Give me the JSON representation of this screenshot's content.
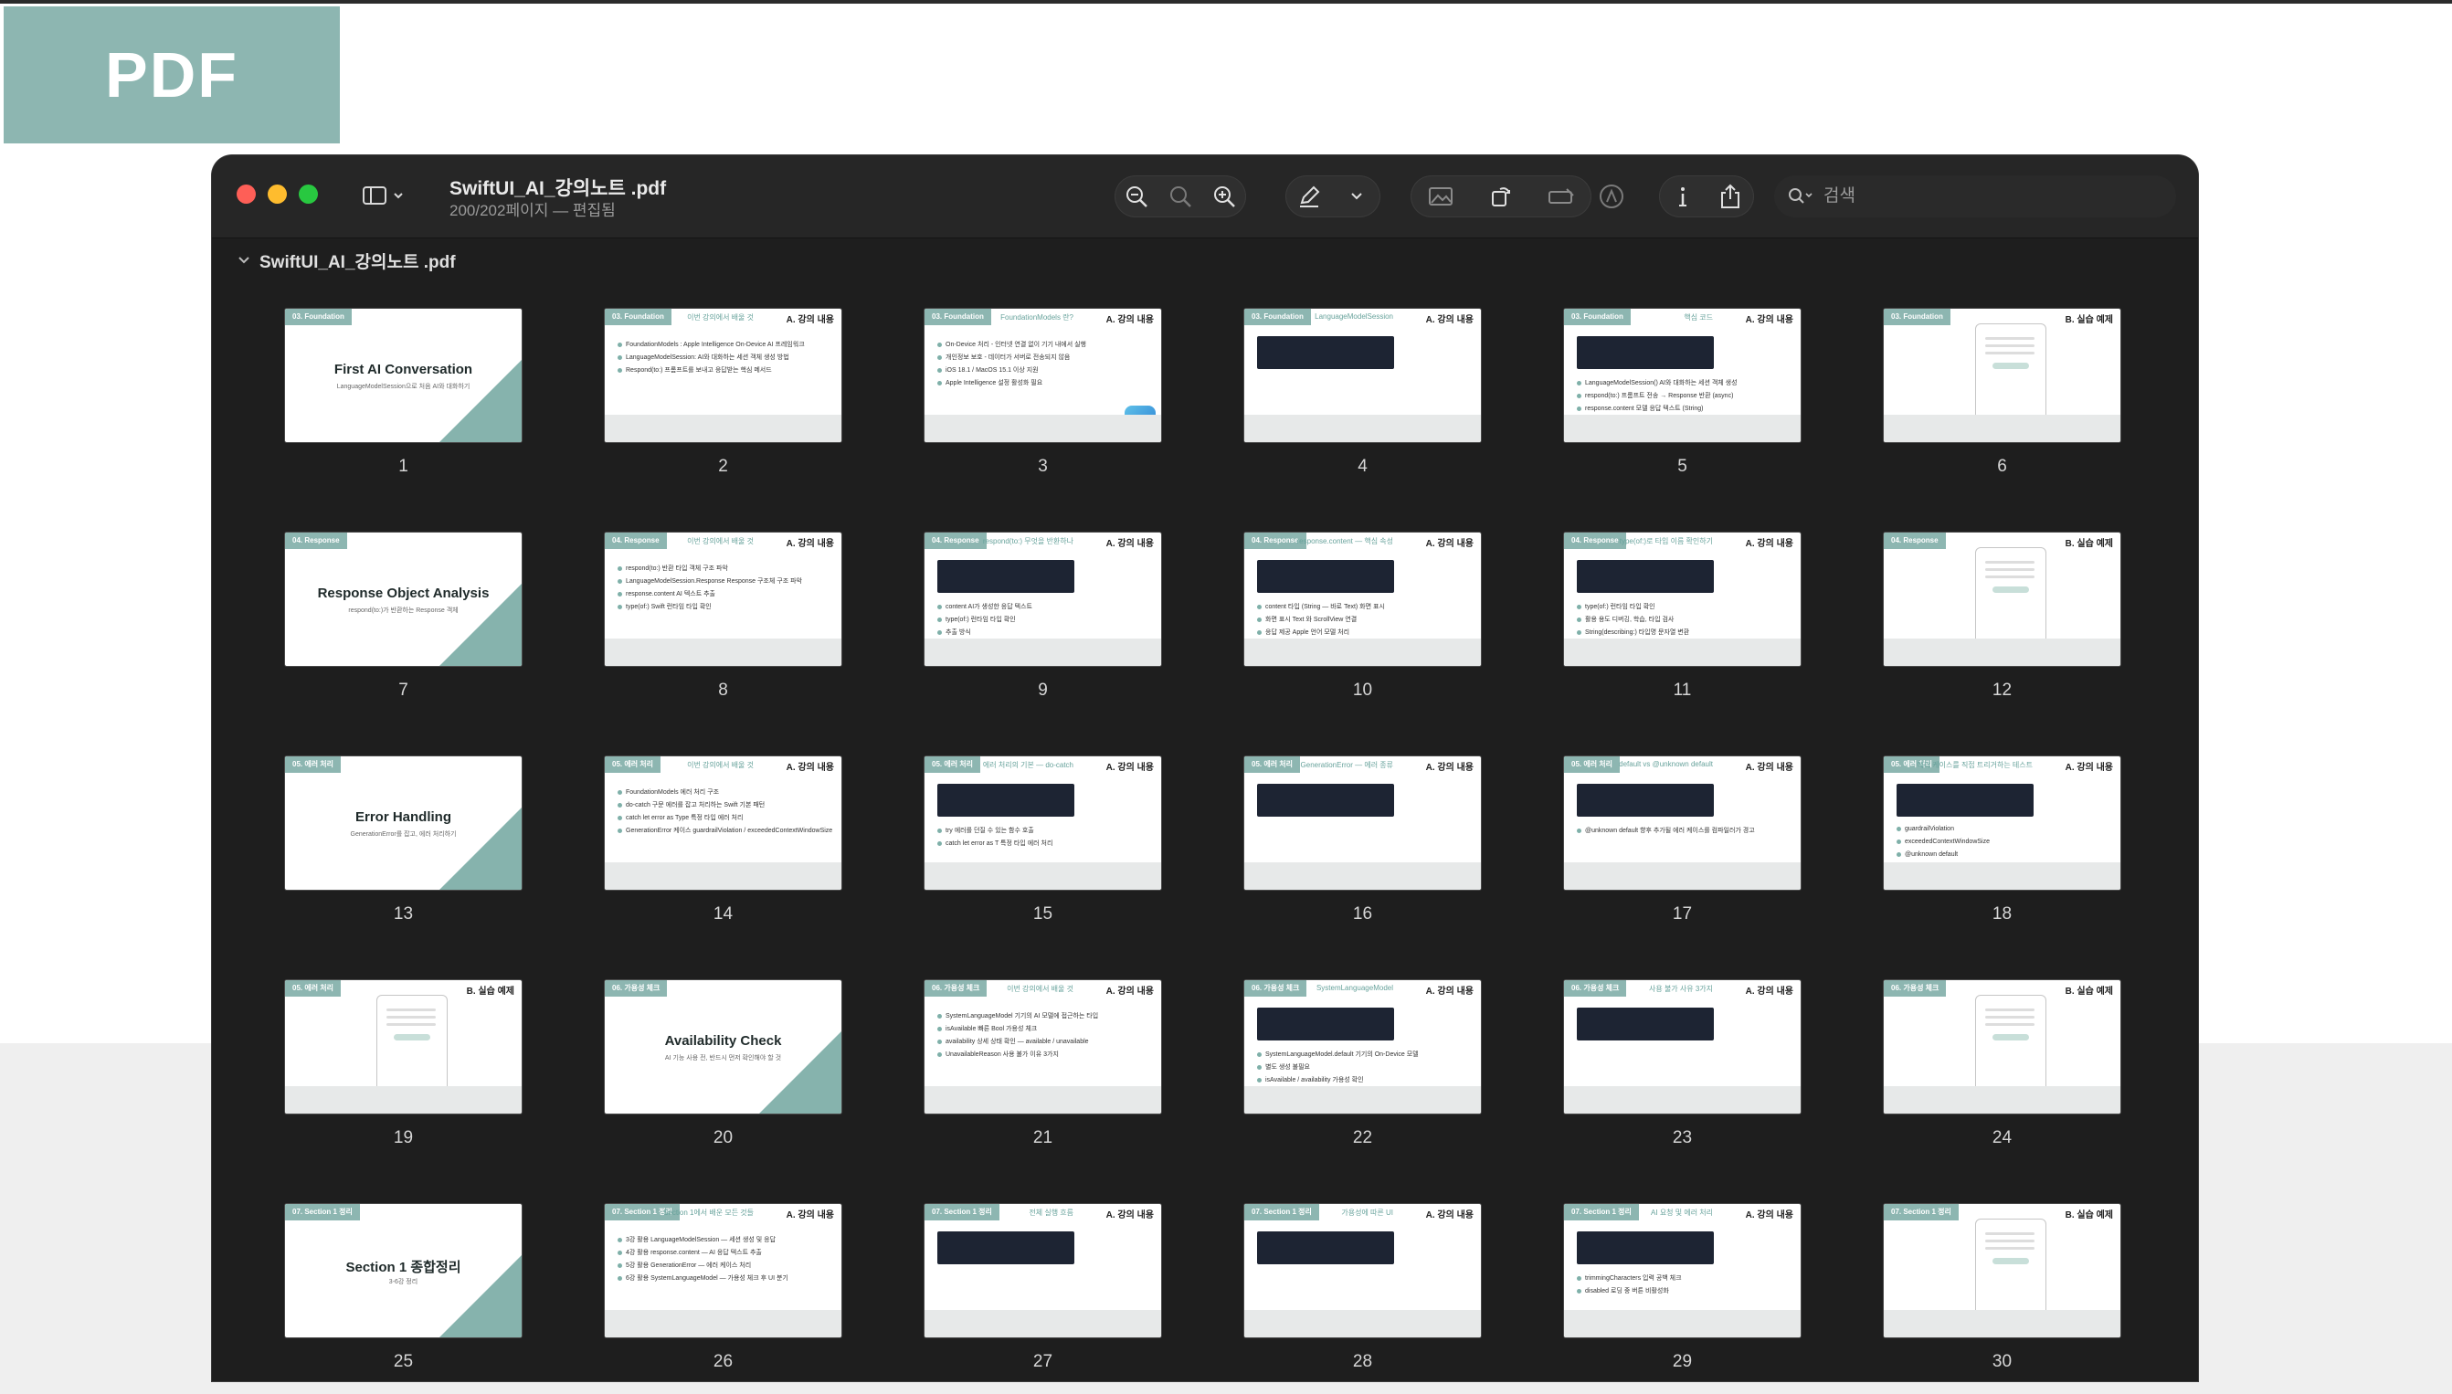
{
  "badge": {
    "label": "PDF"
  },
  "window": {
    "title": "SwiftUI_AI_강의노트 .pdf",
    "subtitle": "200/202페이지 — 편집됨",
    "search_placeholder": "검색",
    "doc_header": "SwiftUI_AI_강의노트 .pdf"
  },
  "colors": {
    "accent": "#8db6b1",
    "window_bg": "#1e1e1e",
    "close": "#fe5f57",
    "minimize": "#febc2e",
    "zoom": "#28c840"
  },
  "toolbar_icons": [
    "sidebar-icon",
    "zoom-out-icon",
    "actual-size-icon",
    "zoom-in-icon",
    "markup-pen-icon",
    "chevron-down-icon",
    "image-edit-icon",
    "rotate-icon",
    "form-icon",
    "annotate-icon",
    "info-icon",
    "share-icon",
    "search-icon"
  ],
  "pages": [
    {
      "num": "1",
      "tag": "03. Foundation",
      "kind": "title",
      "main": "First AI Conversation",
      "sub": "LanguageModelSession으로 처음 AI와 대화하기"
    },
    {
      "num": "2",
      "tag": "03. Foundation",
      "kind": "content",
      "htitle": "이번 강의에서 배울 것",
      "badge": "A. 강의 내용",
      "bullets": [
        "FoundationModels : Apple Intelligence On-Device AI 프레임워크",
        "LanguageModelSession: AI와 대화하는 세션 객체 생성 방법",
        "Respond(to:) 프롬프트를 보내고 응답받는 핵심 메서드"
      ]
    },
    {
      "num": "3",
      "tag": "03. Foundation",
      "kind": "content",
      "htitle": "FoundationModels 란?",
      "badge": "A. 강의 내용",
      "bullets": [
        "On-Device 처리 - 인터넷 연결 없이 기기 내에서 실행",
        "개인정보 보호 - 데이터가 서버로 전송되지 않음",
        "iOS 18.1 / MacOS 15.1 이상 지원",
        "Apple Intelligence 설정 활성화 필요"
      ],
      "icon": true
    },
    {
      "num": "4",
      "tag": "03. Foundation",
      "kind": "content",
      "htitle": "LanguageModelSession",
      "badge": "A. 강의 내용",
      "bullets": [],
      "code": true
    },
    {
      "num": "5",
      "tag": "03. Foundation",
      "kind": "content",
      "htitle": "핵심 코드",
      "badge": "A. 강의 내용",
      "bullets": [
        "LanguageModelSession() AI와 대화하는 세션 객체 생성",
        "respond(to:) 프롬프트 전송 → Response 반환 (async)",
        "response.content 모델 응답 텍스트 (String)"
      ],
      "code": true
    },
    {
      "num": "6",
      "tag": "03. Foundation",
      "kind": "phone",
      "badge": "B. 실습 예제"
    },
    {
      "num": "7",
      "tag": "04. Response",
      "kind": "title",
      "main": "Response Object Analysis",
      "sub": "respond(to:)가 반환하는 Response 객체"
    },
    {
      "num": "8",
      "tag": "04. Response",
      "kind": "content",
      "htitle": "이번 강의에서 배울 것",
      "badge": "A. 강의 내용",
      "bullets": [
        "respond(to:) 반환 타입 객체 구조 파악",
        "LanguageModelSession.Response Response 구조체 구조 파악",
        "response.content AI 텍스트 추출",
        "type(of:) Swift 런타임 타입 확인"
      ]
    },
    {
      "num": "9",
      "tag": "04. Response",
      "kind": "content",
      "htitle": "respond(to:) 무엇을 반환하나",
      "badge": "A. 강의 내용",
      "bullets": [
        "content AI가 생성한 응답 텍스트",
        "type(of:) 런타임 타입 확인",
        "추출 방식"
      ],
      "code": true
    },
    {
      "num": "10",
      "tag": "04. Response",
      "kind": "content",
      "htitle": "response.content — 핵심 속성",
      "badge": "A. 강의 내용",
      "bullets": [
        "content 타입 (String — 바로 Text) 화면 표시",
        "화면 표시 Text 와 ScrollView 연결",
        "응답 제공 Apple 언어 모델 처리"
      ],
      "code": true
    },
    {
      "num": "11",
      "tag": "04. Response",
      "kind": "content",
      "htitle": "type(of:)로 타입 이름 확인하기",
      "badge": "A. 강의 내용",
      "bullets": [
        "type(of:) 런타임 타입 확인",
        "활용 용도 디버깅, 학습, 타입 검사",
        "String(describing:) 타입명 문자열 변환"
      ],
      "code": true
    },
    {
      "num": "12",
      "tag": "04. Response",
      "kind": "phone",
      "badge": "B. 실습 예제"
    },
    {
      "num": "13",
      "tag": "05. 에러 처리",
      "kind": "title",
      "main": "Error Handling",
      "sub": "GenerationError를 잡고, 에러 처리하기"
    },
    {
      "num": "14",
      "tag": "05. 에러 처리",
      "kind": "content",
      "htitle": "이번 강의에서 배울 것",
      "badge": "A. 강의 내용",
      "bullets": [
        "FoundationModels 에러 처리 구조",
        "do-catch 구문 에러를 잡고 처리하는 Swift 기본 패턴",
        "catch let error as Type 특정 타입 에러 처리",
        "GenerationError 케이스 guardrailViolation / exceededContextWindowSize"
      ]
    },
    {
      "num": "15",
      "tag": "05. 에러 처리",
      "kind": "content",
      "htitle": "에러 처리의 기본 — do-catch",
      "badge": "A. 강의 내용",
      "bullets": [
        "try 에러를 던질 수 있는 함수 호출",
        "catch let error as T 특정 타입 에러 처리"
      ],
      "code": true
    },
    {
      "num": "16",
      "tag": "05. 에러 처리",
      "kind": "content",
      "htitle": "GenerationError — 에러 종류",
      "badge": "A. 강의 내용",
      "bullets": [],
      "code": true
    },
    {
      "num": "17",
      "tag": "05. 에러 처리",
      "kind": "content",
      "htitle": "default vs @unknown default",
      "badge": "A. 강의 내용",
      "bullets": [
        "@unknown default 향후 추가될 에러 케이스를 컴파일러가 경고"
      ],
      "code": true
    },
    {
      "num": "18",
      "tag": "05. 에러 처리",
      "kind": "content",
      "htitle": "에러 케이스를 직접 트리거하는 테스트",
      "badge": "A. 강의 내용",
      "bullets": [
        "guardrailViolation",
        "exceededContextWindowSize",
        "@unknown default"
      ],
      "code": true
    },
    {
      "num": "19",
      "tag": "05. 에러 처리",
      "kind": "phone",
      "badge": "B. 실습 예제"
    },
    {
      "num": "20",
      "tag": "06. 가용성 체크",
      "kind": "title",
      "main": "Availability Check",
      "sub": "AI 기능 사용 전, 반드시 먼저 확인해야 할 것"
    },
    {
      "num": "21",
      "tag": "06. 가용성 체크",
      "kind": "content",
      "htitle": "이번 강의에서 배울 것",
      "badge": "A. 강의 내용",
      "bullets": [
        "SystemLanguageModel 기기의 AI 모델에 접근하는 타입",
        "isAvailable 빠른 Bool 가용성 체크",
        "availability 상세 상태 확인 — available / unavailable",
        "UnavailableReason 사용 불가 이유 3가지"
      ]
    },
    {
      "num": "22",
      "tag": "06. 가용성 체크",
      "kind": "content",
      "htitle": "SystemLanguageModel",
      "badge": "A. 강의 내용",
      "bullets": [
        "SystemLanguageModel.default 기기의 On-Device 모델",
        "별도 생성 불필요",
        "isAvailable / availability 가용성 확인"
      ],
      "code": true
    },
    {
      "num": "23",
      "tag": "06. 가용성 체크",
      "kind": "content",
      "htitle": "사용 불가 사유 3가지",
      "badge": "A. 강의 내용",
      "bullets": [],
      "code": true
    },
    {
      "num": "24",
      "tag": "06. 가용성 체크",
      "kind": "phone",
      "badge": "B. 실습 예제"
    },
    {
      "num": "25",
      "tag": "07. Section 1 정리",
      "kind": "title",
      "main": "Section 1 종합정리",
      "sub": "3-6강 정리"
    },
    {
      "num": "26",
      "tag": "07. Section 1 정리",
      "kind": "content",
      "htitle": "Section 1에서 배운 모든 것들",
      "badge": "A. 강의 내용",
      "bullets": [
        "3강 활용 LanguageModelSession — 세션 생성 및 응답",
        "4강 활용 response.content — AI 응답 텍스트 추출",
        "5강 활용 GenerationError — 에러 케이스 처리",
        "6강 활용 SystemLanguageModel — 가용성 체크 후 UI 분기"
      ]
    },
    {
      "num": "27",
      "tag": "07. Section 1 정리",
      "kind": "content",
      "htitle": "전체 실행 흐름",
      "badge": "A. 강의 내용",
      "bullets": [],
      "code": true
    },
    {
      "num": "28",
      "tag": "07. Section 1 정리",
      "kind": "content",
      "htitle": "가용성에 따른 UI",
      "badge": "A. 강의 내용",
      "bullets": [],
      "code": true
    },
    {
      "num": "29",
      "tag": "07. Section 1 정리",
      "kind": "content",
      "htitle": "AI 요청 및 에러 처리",
      "badge": "A. 강의 내용",
      "bullets": [
        "trimmingCharacters 입력 공백 체크",
        "disabled 로딩 중 버튼 비활성화"
      ],
      "code": true
    },
    {
      "num": "30",
      "tag": "07. Section 1 정리",
      "kind": "phone",
      "badge": "B. 실습 예제"
    }
  ]
}
